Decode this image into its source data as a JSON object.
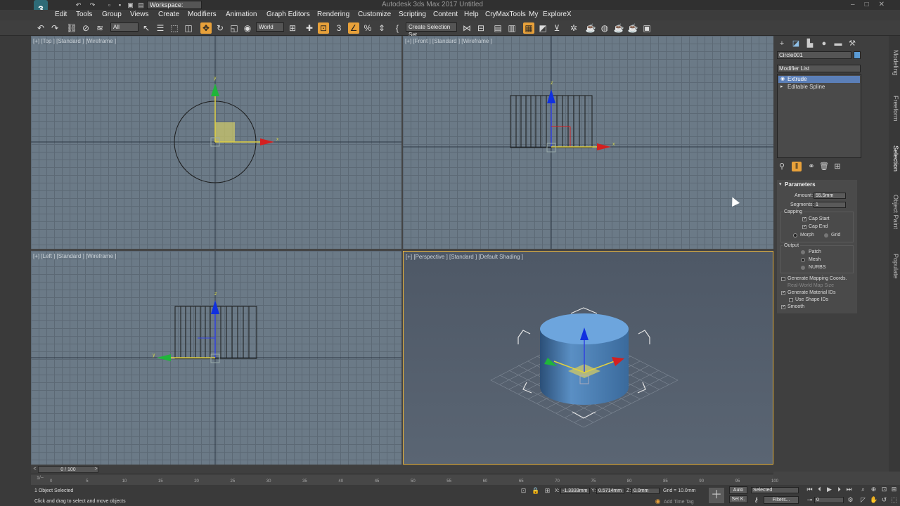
{
  "window": {
    "title": "Autodesk 3ds Max 2017    Untitled",
    "workspace": "Workspace: Default",
    "app_logo": "3"
  },
  "menu": [
    "Edit",
    "Tools",
    "Group",
    "Views",
    "Create",
    "Modifiers",
    "Animation",
    "Graph Editors",
    "Rendering",
    "Customize",
    "Scripting",
    "Content",
    "Help",
    "CryMaxTools",
    "My",
    "ExploreX"
  ],
  "toolbar": {
    "selection_filter": "All",
    "ref_coord": "World",
    "named_selection": "Create Selection Set"
  },
  "viewports": {
    "top_label": "[+] [Top ] [Standard ] [Wireframe ]",
    "front_label": "[+] [Front ] [Standard ] [Wireframe ]",
    "left_label": "[+] [Left ] [Standard ] [Wireframe ]",
    "persp_label": "[+] [Perspective ] [Standard ] [Default Shading ]",
    "axis_x": "x",
    "axis_y": "y",
    "axis_z": "z"
  },
  "command_panel": {
    "object_name": "Circle001",
    "object_color": "#5b9bd5",
    "modifier_list": "Modifier List",
    "stack": [
      {
        "label": "Extrude",
        "selected": true
      },
      {
        "label": "Editable Spline",
        "selected": false
      }
    ],
    "parameters": {
      "title": "Parameters",
      "amount_label": "Amount:",
      "amount_value": "55.5mm",
      "segments_label": "Segments:",
      "segments_value": "1",
      "capping_label": "Capping",
      "cap_start": "Cap Start",
      "cap_end": "Cap End",
      "morph": "Morph",
      "grid": "Grid",
      "output_label": "Output",
      "patch": "Patch",
      "mesh": "Mesh",
      "nurbs": "NURBS",
      "gen_mapping": "Generate Mapping Coords.",
      "real_world": "Real-World Map Size",
      "gen_material": "Generate Material IDs",
      "use_shape_ids": "Use Shape IDs",
      "smooth": "Smooth"
    }
  },
  "side_tabs": [
    "Modeling",
    "Freeform",
    "Selection",
    "Object Paint",
    "Populate"
  ],
  "timeline": {
    "frame_display": "0 / 100",
    "ticks": [
      "0",
      "5",
      "10",
      "15",
      "20",
      "25",
      "30",
      "35",
      "40",
      "45",
      "50",
      "55",
      "60",
      "65",
      "70",
      "75",
      "80",
      "85",
      "90",
      "95",
      "100"
    ]
  },
  "status": {
    "selection_info": "1 Object Selected",
    "prompt": "Click and drag to select and move objects",
    "x_value": "-1.3333mm",
    "y_value": "0.5714mm",
    "z_value": "0.0mm",
    "grid": "Grid = 10.0mm",
    "add_time_tag": "Add Time Tag",
    "auto": "Auto",
    "set_key": "Set K.",
    "key_mode": "Selected",
    "filters": "Filters...",
    "frame": "0",
    "maxscript": "1/~"
  }
}
